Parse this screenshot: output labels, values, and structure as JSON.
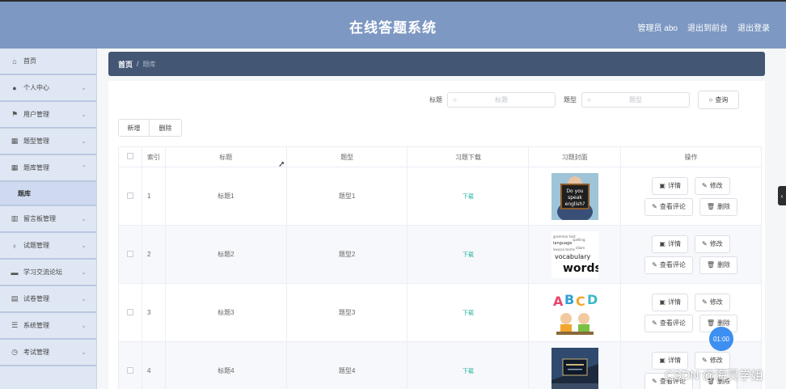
{
  "header": {
    "title": "在线答题系统",
    "user": "管理员 abo",
    "back_label": "退出到前台",
    "logout_label": "退出登录"
  },
  "sidebar": {
    "items": [
      {
        "label": "首页",
        "icon": "home-icon",
        "chevron": ""
      },
      {
        "label": "个人中心",
        "icon": "user-icon",
        "chevron": "⌄"
      },
      {
        "label": "用户管理",
        "icon": "flag-icon",
        "chevron": "⌄"
      },
      {
        "label": "题型管理",
        "icon": "grid-icon",
        "chevron": "⌄"
      },
      {
        "label": "题库管理",
        "icon": "grid-icon",
        "chevron": "⌃"
      },
      {
        "label": "留言板管理",
        "icon": "bar-chart-icon",
        "chevron": "⌄"
      },
      {
        "label": "试题管理",
        "icon": "mic-icon",
        "chevron": "⌄"
      },
      {
        "label": "学习交流论坛",
        "icon": "chat-icon",
        "chevron": "⌄"
      },
      {
        "label": "试卷管理",
        "icon": "doc-icon",
        "chevron": "⌄"
      },
      {
        "label": "系统管理",
        "icon": "list-icon",
        "chevron": "⌄"
      },
      {
        "label": "考试管理",
        "icon": "clock-icon",
        "chevron": "⌄"
      }
    ],
    "active_sub": "题库"
  },
  "breadcrumb": {
    "home": "首页",
    "sep": "/",
    "current": "题库"
  },
  "search": {
    "title_label": "标题",
    "title_placeholder": "标题",
    "type_label": "题型",
    "type_placeholder": "题型",
    "query_label": "查询"
  },
  "toolbar": {
    "add_label": "新增",
    "delete_label": "删除"
  },
  "table": {
    "columns": [
      "",
      "索引",
      "标题",
      "题型",
      "习题下载",
      "习题封面",
      "操作"
    ],
    "download_label": "下载",
    "op_labels": {
      "detail": "详情",
      "edit": "修改",
      "comments": "查看评论",
      "delete": "删除"
    },
    "rows": [
      {
        "index": "1",
        "title": "标题1",
        "type": "题型1",
        "cover": "do-you-speak-english-image"
      },
      {
        "index": "2",
        "title": "标题2",
        "type": "题型2",
        "cover": "vocabulary-words-image"
      },
      {
        "index": "3",
        "title": "标题3",
        "type": "题型3",
        "cover": "abcd-kids-image"
      },
      {
        "index": "4",
        "title": "标题4",
        "type": "题型4",
        "cover": "business-book-image"
      }
    ]
  },
  "timer": "01:00",
  "watermark": "CSDN @海灵学姐"
}
